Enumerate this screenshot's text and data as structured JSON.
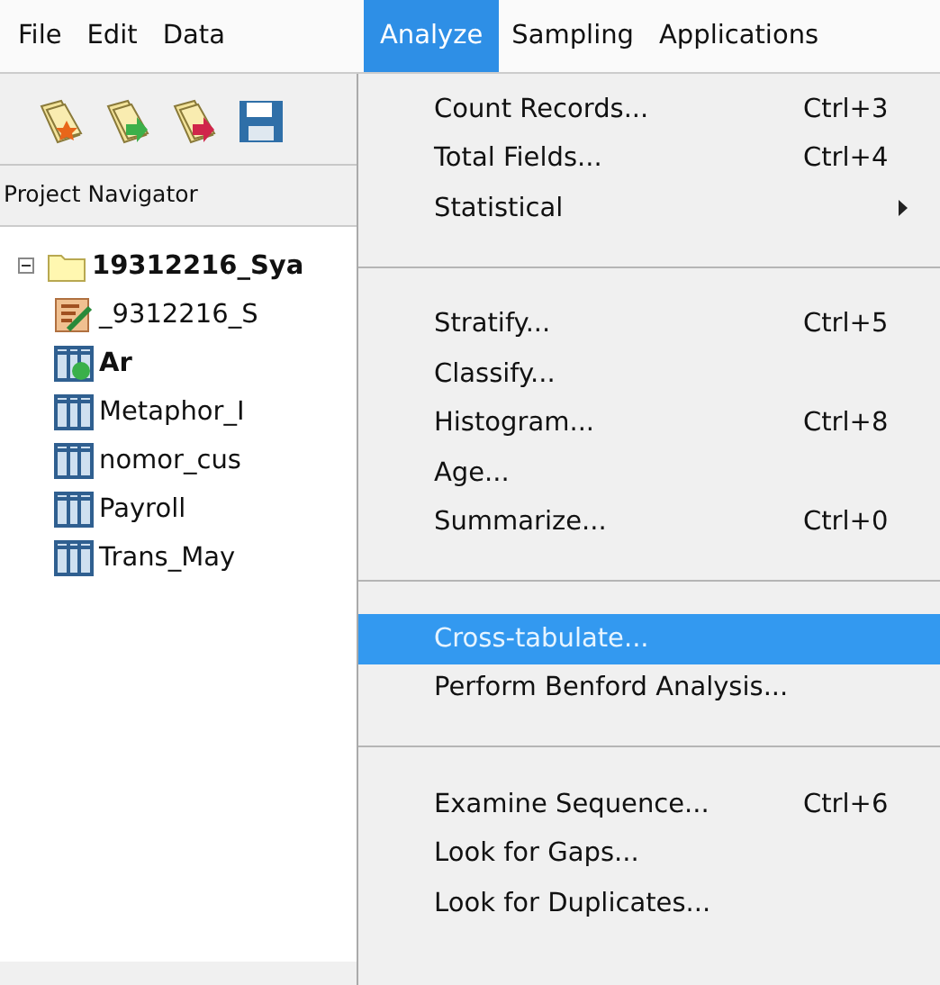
{
  "menu_bar": [
    {
      "label": "File",
      "selected": false
    },
    {
      "label": "Edit",
      "selected": false
    },
    {
      "label": "Data",
      "selected": false
    },
    {
      "label": "Analyze",
      "selected": true
    },
    {
      "label": "Sampling",
      "selected": false
    },
    {
      "label": "Applications",
      "selected": false
    }
  ],
  "project_navigator": {
    "title": "Project Navigator",
    "tree": [
      {
        "label": "19312216_Sya",
        "kind": "folder",
        "bold": true,
        "expanded": true,
        "children": [
          {
            "label": "_9312216_S",
            "kind": "script",
            "bold": false
          },
          {
            "label": "Ar",
            "kind": "table-linked",
            "bold": true
          },
          {
            "label": "Metaphor_I",
            "kind": "table",
            "bold": false
          },
          {
            "label": "nomor_cus",
            "kind": "table",
            "bold": false
          },
          {
            "label": "Payroll",
            "kind": "table",
            "bold": false
          },
          {
            "label": "Trans_May",
            "kind": "table",
            "bold": false
          }
        ]
      }
    ]
  },
  "analyze_menu": [
    {
      "kind": "item",
      "label": "Count Records...",
      "shortcut": "Ctrl+3",
      "selected": false
    },
    {
      "kind": "item",
      "label": "Total Fields...",
      "shortcut": "Ctrl+4",
      "selected": false
    },
    {
      "kind": "item",
      "label": "Statistical",
      "submenu": true,
      "selected": false
    },
    {
      "kind": "separator"
    },
    {
      "kind": "item",
      "label": "Stratify...",
      "shortcut": "Ctrl+5",
      "selected": false
    },
    {
      "kind": "item",
      "label": "Classify...",
      "selected": false
    },
    {
      "kind": "item",
      "label": "Histogram...",
      "shortcut": "Ctrl+8",
      "selected": false
    },
    {
      "kind": "item",
      "label": "Age...",
      "selected": false
    },
    {
      "kind": "item",
      "label": "Summarize...",
      "shortcut": "Ctrl+0",
      "selected": false
    },
    {
      "kind": "separator"
    },
    {
      "kind": "item",
      "label": "Cross-tabulate...",
      "selected": true
    },
    {
      "kind": "item",
      "label": "Perform Benford Analysis...",
      "selected": false
    },
    {
      "kind": "separator"
    },
    {
      "kind": "item",
      "label": "Examine Sequence...",
      "shortcut": "Ctrl+6",
      "selected": false
    },
    {
      "kind": "item",
      "label": "Look for Gaps...",
      "selected": false
    },
    {
      "kind": "item",
      "label": "Look for Duplicates...",
      "selected": false
    }
  ]
}
